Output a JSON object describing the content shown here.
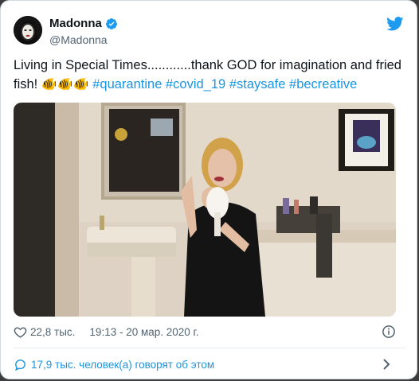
{
  "author": {
    "name": "Madonna",
    "handle": "@Madonna"
  },
  "tweet": {
    "text_before": "Living in Special Times............thank GOD for imagination and fried fish! ",
    "fish_emoji": "🐠🐠🐠",
    "hashtags": [
      "#quarantine",
      "#covid_19",
      "#staysafe",
      "#becreative"
    ]
  },
  "stats": {
    "likes": "22,8 тыс.",
    "timestamp": "19:13 - 20 мар. 2020 г."
  },
  "conversation": {
    "label": "17,9 тыс. человек(а) говорят об этом"
  },
  "colors": {
    "accent": "#1b95e0",
    "text": "#0f1419",
    "muted": "#536471"
  },
  "icons": [
    "verified-badge-icon",
    "twitter-bird-icon",
    "heart-icon",
    "info-icon",
    "comment-icon",
    "chevron-right-icon"
  ]
}
